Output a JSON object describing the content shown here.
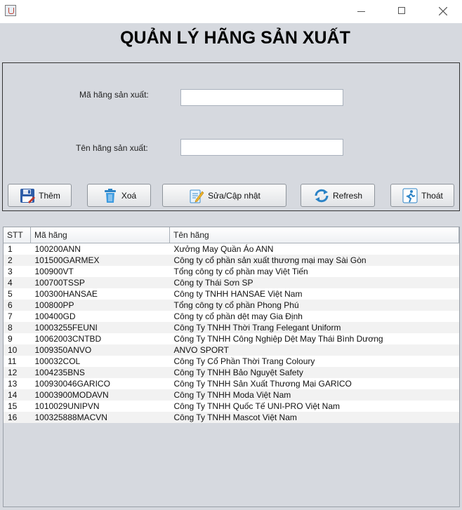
{
  "window": {
    "icon": "java-cup-icon",
    "controls": [
      "minimize-icon",
      "maximize-icon",
      "close-icon"
    ]
  },
  "title": "QUẢN LÝ HÃNG SẢN XUẤT",
  "form": {
    "code_label": "Mã hãng sản xuất:",
    "code_value": "",
    "name_label": "Tên hãng sản xuất:",
    "name_value": ""
  },
  "buttons": {
    "add": {
      "label": "Thêm",
      "icon": "floppy-disk-icon"
    },
    "delete": {
      "label": "Xoá",
      "icon": "trash-icon"
    },
    "update": {
      "label": "Sửa/Cập nhật",
      "icon": "edit-document-icon"
    },
    "refresh": {
      "label": "Refresh",
      "icon": "refresh-arrows-icon"
    },
    "exit": {
      "label": "Thoát",
      "icon": "exit-door-icon"
    }
  },
  "table": {
    "columns": [
      "STT",
      "Mã hãng",
      "Tên hãng"
    ],
    "rows": [
      [
        "1",
        "100200ANN",
        "Xưởng May Quần Áo ANN"
      ],
      [
        "2",
        "101500GARMEX",
        "Công ty cổ phần sản xuất thương mại may Sài Gòn"
      ],
      [
        "3",
        "100900VT",
        "Tổng công ty cổ phần may Việt Tiến"
      ],
      [
        "4",
        "100700TSSP",
        "Công ty Thái Sơn SP"
      ],
      [
        "5",
        "100300HANSAE",
        "Công ty TNHH HANSAE Việt Nam"
      ],
      [
        "6",
        "100800PP",
        "Tổng công ty cổ phần Phong Phú"
      ],
      [
        "7",
        "100400GD",
        "Công ty cổ phần dệt may Gia Định"
      ],
      [
        "8",
        "10003255FEUNI",
        "Công Ty TNHH Thời Trang Felegant Uniform"
      ],
      [
        "9",
        "10062003CNTBD",
        "Công Ty TNHH Công Nghiệp Dệt May Thái Bình Dương"
      ],
      [
        "10",
        "1009350ANVO",
        "ANVO SPORT"
      ],
      [
        "11",
        "100032COL",
        "Công Ty Cổ Phần Thời Trang Coloury"
      ],
      [
        "12",
        "1004235BNS",
        "Công Ty TNHH Bảo Nguyệt Safety"
      ],
      [
        "13",
        "100930046GARICO",
        "Công Ty TNHH Sản Xuất Thương Mại GARICO"
      ],
      [
        "14",
        "10003900MODAVN",
        "Công Ty TNHH Moda Việt Nam"
      ],
      [
        "15",
        "1010029UNIPVN",
        "Công Ty TNHH Quốc Tế UNI-PRO Việt Nam"
      ],
      [
        "16",
        "100325888MACVN",
        "Công Ty TNHH Mascot Việt Nam"
      ]
    ]
  }
}
